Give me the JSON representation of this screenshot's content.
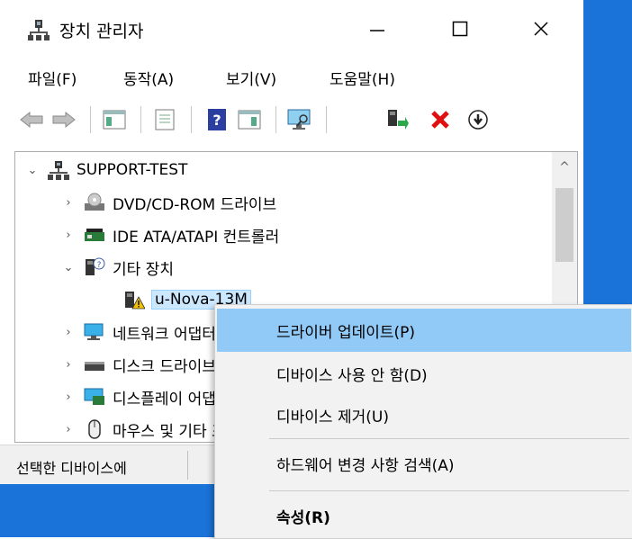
{
  "window": {
    "title": "장치 관리자",
    "controls": {
      "minimize": "—",
      "maximize": "☐",
      "close": "✕"
    }
  },
  "menu": [
    "파일(F)",
    "동작(A)",
    "보기(V)",
    "도움말(H)"
  ],
  "toolbar": {
    "icons": [
      "back-arrow-icon",
      "forward-arrow-icon",
      "show-hide-console-tree-icon",
      "properties-icon",
      "help-icon",
      "action-pane-icon",
      "monitor-scan-icon",
      "update-driver-icon",
      "uninstall-x-icon",
      "disable-device-icon"
    ]
  },
  "tree": {
    "root": {
      "label": "SUPPORT-TEST",
      "expanded": true
    },
    "items": [
      {
        "label": "DVD/CD-ROM 드라이브",
        "expanded": false,
        "icon": "dvd-drive-icon"
      },
      {
        "label": "IDE ATA/ATAPI 컨트롤러",
        "expanded": false,
        "icon": "ide-controller-icon"
      },
      {
        "label": "기타 장치",
        "expanded": true,
        "icon": "unknown-device-icon"
      },
      {
        "label": "u-Nova-13M",
        "child": true,
        "selected": true,
        "icon": "warning-device-icon"
      },
      {
        "label": "네트워크 어댑터",
        "expanded": false,
        "icon": "network-adapter-icon"
      },
      {
        "label": "디스크 드라이브",
        "expanded": false,
        "icon": "disk-drive-icon"
      },
      {
        "label": "디스플레이 어댑터",
        "expanded": false,
        "icon": "display-adapter-icon"
      },
      {
        "label": "마우스 및 기타 포인팅 장치",
        "expanded": false,
        "icon": "mouse-icon"
      }
    ]
  },
  "status": {
    "text": "선택한 디바이스에"
  },
  "context_menu": {
    "items": [
      {
        "label": "드라이버 업데이트(P)",
        "highlighted": true
      },
      {
        "label": "디바이스 사용 안 함(D)"
      },
      {
        "label": "디바이스 제거(U)"
      },
      {
        "label": "하드웨어 변경 사항 검색(A)"
      },
      {
        "label": "속성(R)",
        "bold": true
      }
    ]
  },
  "colors": {
    "desktop": "#1a73d8",
    "highlight": "#91c9f7",
    "selection": "#cce8ff"
  }
}
